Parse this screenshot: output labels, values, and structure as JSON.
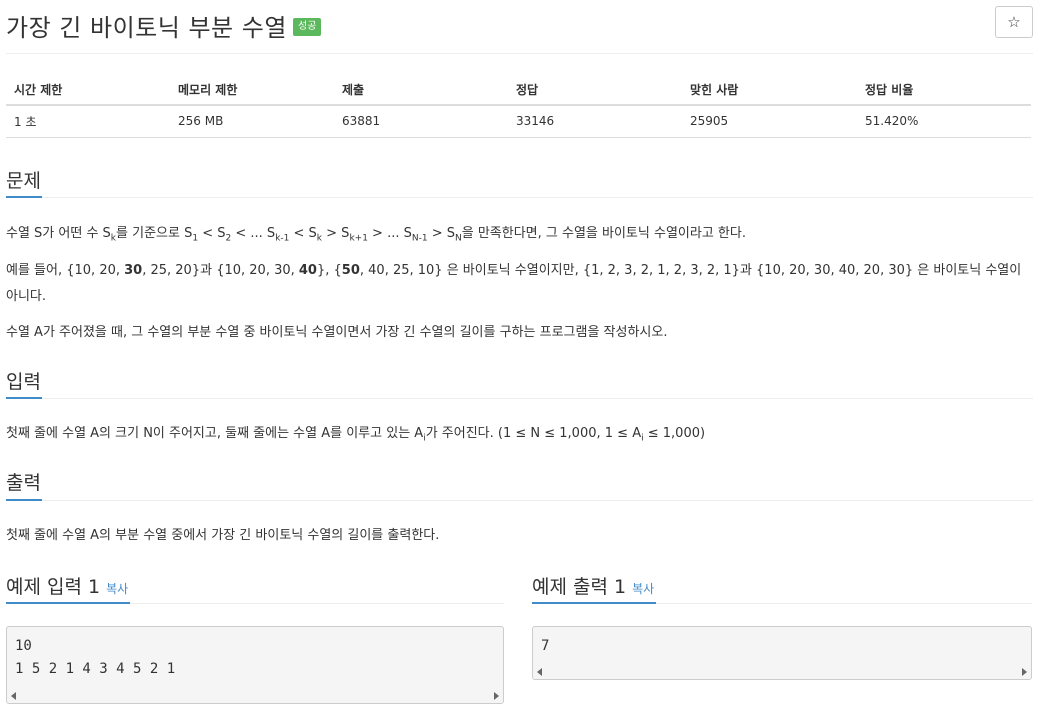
{
  "problem": {
    "title": "가장 긴 바이토닉 부분 수열",
    "status_badge": "성공",
    "star": "☆"
  },
  "info_table": {
    "headers": [
      "시간 제한",
      "메모리 제한",
      "제출",
      "정답",
      "맞힌 사람",
      "정답 비율"
    ],
    "values": [
      "1 초",
      "256 MB",
      "63881",
      "33146",
      "25905",
      "51.420%"
    ]
  },
  "sections": {
    "description": "문제",
    "input": "입력",
    "output": "출력"
  },
  "description": {
    "p1": {
      "t0": "수열 S가 어떤 수 S",
      "s0": "k",
      "t1": "를 기준으로 S",
      "s1": "1",
      "t2": " < S",
      "s2": "2",
      "t3": " < ... S",
      "s3": "k-1",
      "t4": " < S",
      "s4": "k",
      "t5": " > S",
      "s5": "k+1",
      "t6": " > ... S",
      "s6": "N-1",
      "t7": " > S",
      "s7": "N",
      "t8": "을 만족한다면, 그 수열을 바이토닉 수열이라고 한다."
    },
    "p2": {
      "t0": "예를 들어, {10, 20, ",
      "b0": "30",
      "t1": ", 25, 20}과 {10, 20, 30, ",
      "b1": "40",
      "t2": "}, {",
      "b2": "50",
      "t3": ", 40, 25, 10} 은 바이토닉 수열이지만, {1, 2, 3, 2, 1, 2, 3, 2, 1}과 {10, 20, 30, 40, 20, 30} 은 바이토닉 수열이 아니다."
    },
    "p3": "수열 A가 주어졌을 때, 그 수열의 부분 수열 중 바이토닉 수열이면서 가장 긴 수열의 길이를 구하는 프로그램을 작성하시오."
  },
  "input_text": {
    "t0": "첫째 줄에 수열 A의 크기 N이 주어지고, 둘째 줄에는 수열 A를 이루고 있는 A",
    "s0": "i",
    "t1": "가 주어진다. (1 ≤ N ≤ 1,000, 1 ≤ A",
    "s1": "i",
    "t2": " ≤ 1,000)"
  },
  "output_text": "첫째 줄에 수열 A의 부분 수열 중에서 가장 긴 바이토닉 수열의 길이를 출력한다.",
  "samples": {
    "input_title": "예제 입력 1",
    "output_title": "예제 출력 1",
    "copy_label": "복사",
    "input_value": "10\n1 5 2 1 4 3 4 5 2 1",
    "output_value": "7"
  }
}
